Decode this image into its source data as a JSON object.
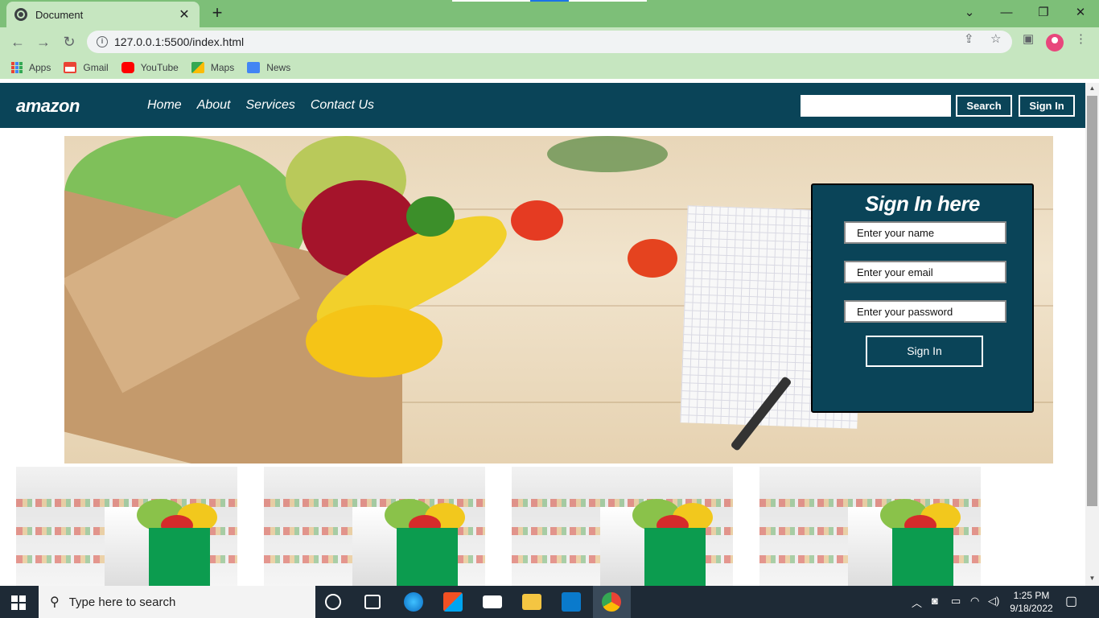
{
  "browser": {
    "tab_title": "Document",
    "tab_close": "✕",
    "new_tab": "+",
    "url": "127.0.0.1:5500/index.html",
    "window_controls": {
      "minimize": "—",
      "restore": "❐",
      "close": "✕",
      "menu": "⌄"
    },
    "bookmarks": [
      {
        "label": "Apps",
        "icon": "apps-grid-icon"
      },
      {
        "label": "Gmail",
        "icon": "gmail-icon",
        "color": "#ea4335"
      },
      {
        "label": "YouTube",
        "icon": "youtube-icon",
        "color": "#ff0000"
      },
      {
        "label": "Maps",
        "icon": "maps-icon",
        "color": "#34a853"
      },
      {
        "label": "News",
        "icon": "news-icon",
        "color": "#4285f4"
      }
    ]
  },
  "navbar": {
    "logo": "amazon",
    "links": [
      "Home",
      "About",
      "Services",
      "Contact Us"
    ],
    "search_value": "",
    "search_button": "Search",
    "signin_button": "Sign In",
    "background_color": "#0a4458"
  },
  "signin_form": {
    "title": "Sign In here",
    "name_placeholder": "Enter your name",
    "email_placeholder": "Enter your email",
    "password_placeholder": "Enter your password",
    "submit_label": "Sign In"
  },
  "hero": {
    "description_icon": "groceries-hero-image"
  },
  "thumbnails": [
    {
      "icon": "grocery-bag-image"
    },
    {
      "icon": "grocery-bag-image"
    },
    {
      "icon": "grocery-bag-image"
    },
    {
      "icon": "grocery-bag-image"
    }
  ],
  "taskbar": {
    "search_placeholder": "Type here to search",
    "time": "1:25 PM",
    "date": "9/18/2022"
  }
}
